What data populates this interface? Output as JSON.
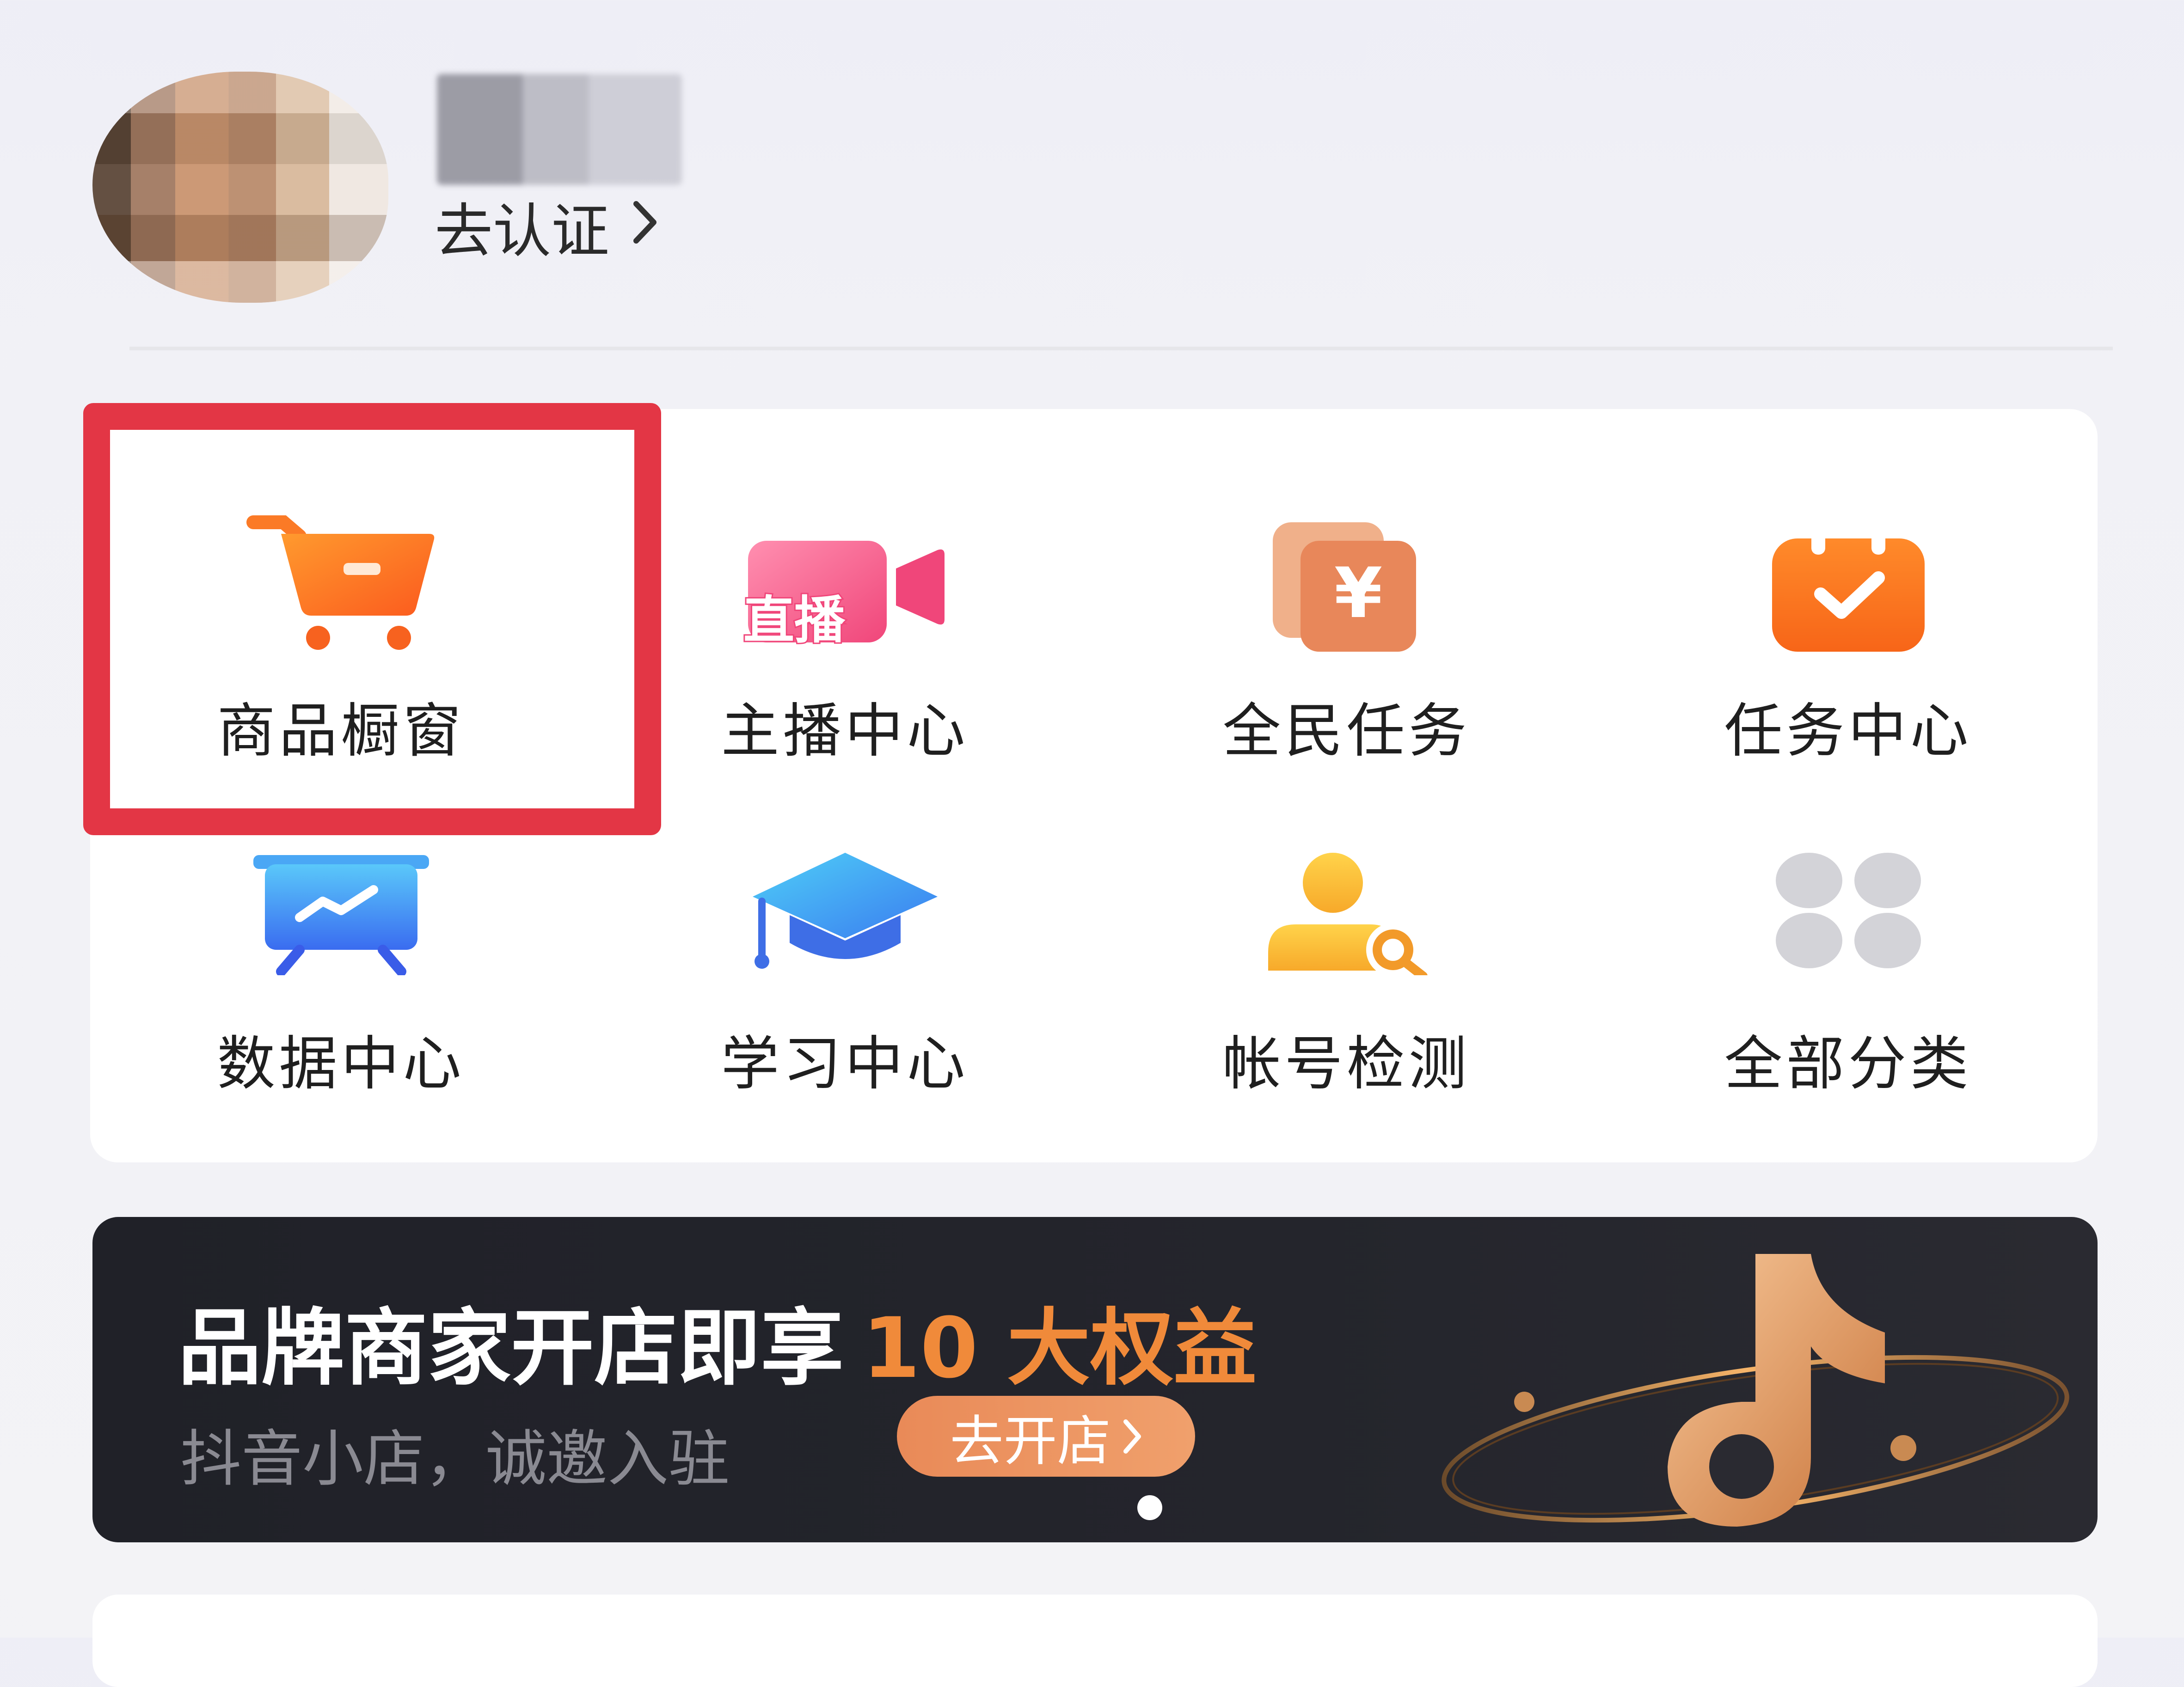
{
  "profile": {
    "verify_label": "去认证",
    "verify_chevron": "chevron-right-icon"
  },
  "grid": {
    "items": [
      {
        "label": "商品橱窗",
        "icon": "shopping-cart-icon",
        "highlighted": true
      },
      {
        "label": "主播中心",
        "icon": "live-camera-icon",
        "icon_text": "直播"
      },
      {
        "label": "全民任务",
        "icon": "yuan-coins-icon",
        "icon_text": "¥"
      },
      {
        "label": "任务中心",
        "icon": "calendar-check-icon"
      },
      {
        "label": "数据中心",
        "icon": "data-board-icon"
      },
      {
        "label": "学习中心",
        "icon": "graduation-cap-icon"
      },
      {
        "label": "帐号检测",
        "icon": "user-search-icon"
      },
      {
        "label": "全部分类",
        "icon": "all-categories-icon"
      }
    ]
  },
  "banner": {
    "title": "品牌商家开店即享",
    "title_highlight": "10 大权益",
    "subtitle": "抖音小店，诚邀入驻",
    "button_label": "去开店",
    "logo": "douyin-note-logo"
  },
  "colors": {
    "highlight_border": "#e33645",
    "accent_orange": "#f08a3a",
    "banner_bg": "#212229"
  }
}
